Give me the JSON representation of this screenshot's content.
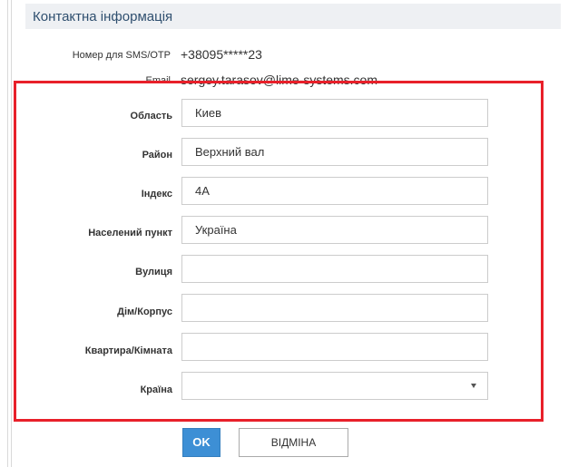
{
  "section": {
    "title": "Контактна інформація"
  },
  "contact": {
    "sms_label": "Номер для SMS/OTP",
    "sms_value": "+38095*****23",
    "email_label": "Email",
    "email_value": "sergey.tarasov@lime-systems.com"
  },
  "form": {
    "fields": [
      {
        "label": "Область",
        "value": "Киев"
      },
      {
        "label": "Район",
        "value": "Верхний вал"
      },
      {
        "label": "Індекс",
        "value": "4А"
      },
      {
        "label": "Населений пункт",
        "value": "Україна"
      },
      {
        "label": "Вулиця",
        "value": ""
      },
      {
        "label": "Дім/Корпус",
        "value": ""
      },
      {
        "label": "Квартира/Кімната",
        "value": ""
      },
      {
        "label": "Країна",
        "value": ""
      }
    ],
    "highlight_color": "#e8202a"
  },
  "buttons": {
    "ok_label": "OK",
    "cancel_label": "ВІДМІНА",
    "primary_color": "#3d8fd5"
  }
}
